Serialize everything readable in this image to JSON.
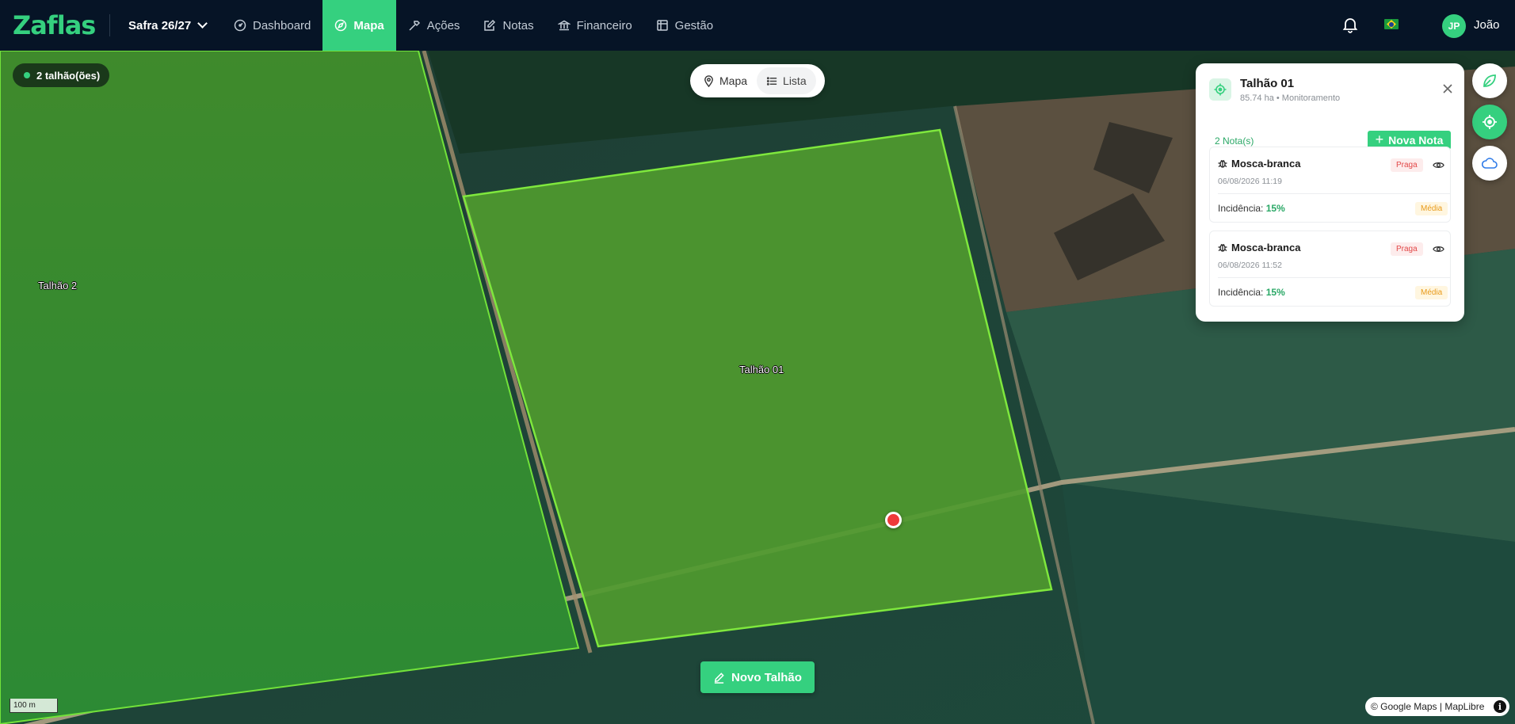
{
  "nav": {
    "logo": "Zaflas",
    "season": "Safra 26/27",
    "items": [
      {
        "label": "Dashboard",
        "icon": "gauge-icon"
      },
      {
        "label": "Mapa",
        "icon": "compass-icon",
        "active": true
      },
      {
        "label": "Ações",
        "icon": "hammer-icon"
      },
      {
        "label": "Notas",
        "icon": "edit-icon"
      },
      {
        "label": "Financeiro",
        "icon": "bank-icon"
      },
      {
        "label": "Gestão",
        "icon": "grid-icon"
      }
    ],
    "user_initials": "JP",
    "user_name": "João",
    "accent": "#35d07f",
    "background": "#061426"
  },
  "map": {
    "field_count": "2 talhão(ões)",
    "view_toggle": {
      "map": "Mapa",
      "list": "Lista"
    },
    "fields": [
      "Talhão 2",
      "Talhão 01"
    ],
    "new_field_button": "Novo Talhão",
    "scale": "100 m",
    "attribution": "© Google Maps | MapLibre",
    "marker_color": "#ee3a3a"
  },
  "tools": [
    "leaf-icon",
    "crosshair-icon",
    "cloud-icon"
  ],
  "panel": {
    "title": "Talhão 01",
    "subtitle": "85.74 ha • Monitoramento",
    "notes_count": "2 Nota(s)",
    "new_note_button": "Nova Nota",
    "notes": [
      {
        "name": "Mosca-branca",
        "date": "06/08/2026 11:19",
        "type": "Praga",
        "incidence_label": "Incidência:",
        "incidence": "15%",
        "severity": "Média"
      },
      {
        "name": "Mosca-branca",
        "date": "06/08/2026 11:52",
        "type": "Praga",
        "incidence_label": "Incidência:",
        "incidence": "15%",
        "severity": "Média"
      }
    ]
  }
}
